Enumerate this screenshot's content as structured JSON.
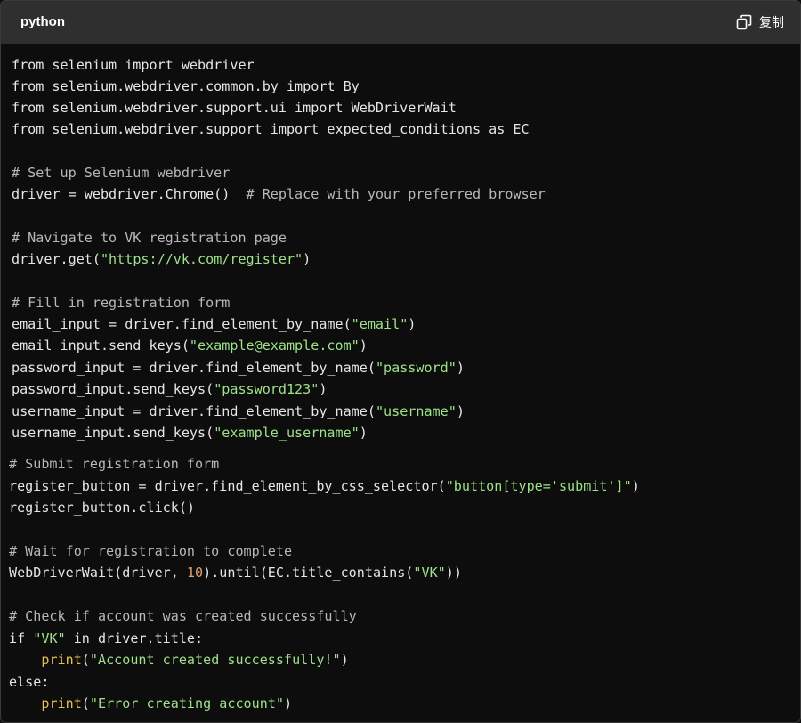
{
  "header": {
    "language": "python",
    "copy_label": "复制"
  },
  "colors": {
    "background": "#0d0d0d",
    "header": "#2f2f2f",
    "text": "#e6e6e6",
    "comment": "#b8b8b8",
    "string": "#9ee28a",
    "number": "#e8a06a",
    "builtin": "#e8c24f"
  },
  "code": {
    "l1": "from selenium import webdriver",
    "l2": "from selenium.webdriver.common.by import By",
    "l3": "from selenium.webdriver.support.ui import WebDriverWait",
    "l4": "from selenium.webdriver.support import expected_conditions as EC",
    "l6": "# Set up Selenium webdriver",
    "l7a": "driver = webdriver.Chrome()",
    "l7b": "  # Replace with your preferred browser",
    "l9": "# Navigate to VK registration page",
    "l10a": "driver.get(",
    "l10s": "\"https://vk.com/register\"",
    "l10b": ")",
    "l12": "# Fill in registration form",
    "l13a": "email_input = driver.find_element_by_name(",
    "l13s": "\"email\"",
    "l13b": ")",
    "l14a": "email_input.send_keys(",
    "l14s": "\"example@example.com\"",
    "l14b": ")",
    "l15a": "password_input = driver.find_element_by_name(",
    "l15s": "\"password\"",
    "l15b": ")",
    "l16a": "password_input.send_keys(",
    "l16s": "\"password123\"",
    "l16b": ")",
    "l17a": "username_input = driver.find_element_by_name(",
    "l17s": "\"username\"",
    "l17b": ")",
    "l18a": "username_input.send_keys(",
    "l18s": "\"example_username\"",
    "l18b": ")",
    "l20": "# Submit registration form",
    "l21a": "register_button = driver.find_element_by_css_selector(",
    "l21s": "\"button[type='submit']\"",
    "l21b": ")",
    "l22": "register_button.click()",
    "l24": "# Wait for registration to complete",
    "l25a": "WebDriverWait(driver, ",
    "l25n": "10",
    "l25b": ").until(EC.title_contains(",
    "l25s": "\"VK\"",
    "l25c": "))",
    "l27": "# Check if account was created successfully",
    "l28a": "if ",
    "l28s": "\"VK\"",
    "l28b": " in driver.title:",
    "l29i": "    ",
    "l29f": "print",
    "l29a": "(",
    "l29s": "\"Account created successfully!\"",
    "l29b": ")",
    "l30": "else:",
    "l31i": "    ",
    "l31f": "print",
    "l31a": "(",
    "l31s": "\"Error creating account\"",
    "l31b": ")"
  }
}
